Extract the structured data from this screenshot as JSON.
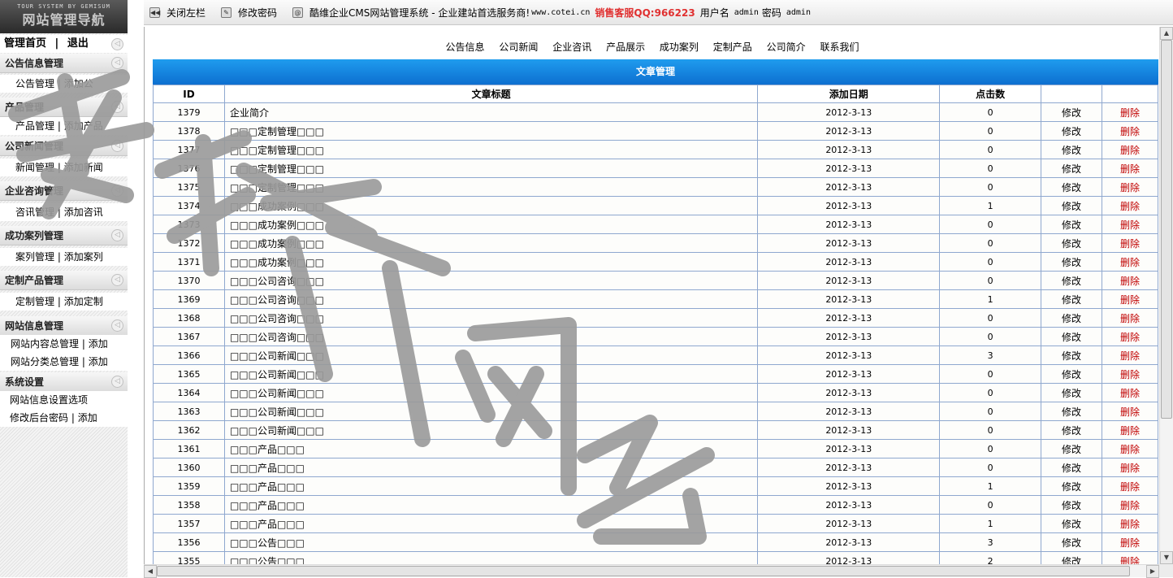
{
  "sidebar": {
    "logo_small": "TOUR SYSTEM BY GEMISUM",
    "logo_big": "网站管理导航",
    "top_links": [
      "管理首页",
      "退出"
    ],
    "sections": [
      {
        "title": "公告信息管理",
        "links": [
          "公告管理",
          "添加公"
        ]
      },
      {
        "title": "产品管理",
        "links": [
          "产品管理",
          "添加产品"
        ]
      },
      {
        "title": "公司新闻管理",
        "links": [
          "新闻管理",
          "添加新闻"
        ]
      },
      {
        "title": "企业咨询管理",
        "links": [
          "咨讯管理",
          "添加咨讯"
        ]
      },
      {
        "title": "成功案列管理",
        "links": [
          "案列管理",
          "添加案列"
        ]
      },
      {
        "title": "定制产品管理",
        "links": [
          "定制管理",
          "添加定制"
        ]
      },
      {
        "title": "网站信息管理",
        "lines": [
          [
            "网站内容总管理",
            "添加"
          ],
          [
            "网站分类总管理",
            "添加"
          ]
        ]
      },
      {
        "title": "系统设置",
        "lines": [
          [
            "网站信息设置选项"
          ],
          [
            "修改后台密码",
            "添加"
          ]
        ]
      }
    ]
  },
  "toolbar": {
    "close_left": "关闭左栏",
    "change_pwd": "修改密码",
    "system_title": "酷维企业CMS网站管理系统 - 企业建站首选服务商!",
    "site_url": "www.cotei.cn",
    "sales_qq": "销售客服QQ:966223",
    "user_label": "用户名",
    "user_value": "admin",
    "pwd_label": "密码",
    "pwd_value": "admin"
  },
  "category_nav": [
    "公告信息",
    "公司新闻",
    "企业咨讯",
    "产品展示",
    "成功案列",
    "定制产品",
    "公司简介",
    "联系我们"
  ],
  "banner_title": "文章管理",
  "table": {
    "headers": [
      "ID",
      "文章标题",
      "添加日期",
      "点击数",
      "",
      ""
    ],
    "edit_label": "修改",
    "delete_label": "删除",
    "rows": [
      {
        "id": "1379",
        "title": "企业简介",
        "date": "2012-3-13",
        "clicks": "0"
      },
      {
        "id": "1378",
        "title": "□□□定制管理□□□",
        "date": "2012-3-13",
        "clicks": "0"
      },
      {
        "id": "1377",
        "title": "□□□定制管理□□□",
        "date": "2012-3-13",
        "clicks": "0"
      },
      {
        "id": "1376",
        "title": "□□□定制管理□□□",
        "date": "2012-3-13",
        "clicks": "0"
      },
      {
        "id": "1375",
        "title": "□□□定制管理□□□",
        "date": "2012-3-13",
        "clicks": "0"
      },
      {
        "id": "1374",
        "title": "□□□成功案例□□□",
        "date": "2012-3-13",
        "clicks": "1"
      },
      {
        "id": "1373",
        "title": "□□□成功案例□□□",
        "date": "2012-3-13",
        "clicks": "0"
      },
      {
        "id": "1372",
        "title": "□□□成功案例□□□",
        "date": "2012-3-13",
        "clicks": "0"
      },
      {
        "id": "1371",
        "title": "□□□成功案例□□□",
        "date": "2012-3-13",
        "clicks": "0"
      },
      {
        "id": "1370",
        "title": "□□□公司咨询□□□",
        "date": "2012-3-13",
        "clicks": "0"
      },
      {
        "id": "1369",
        "title": "□□□公司咨询□□□",
        "date": "2012-3-13",
        "clicks": "1"
      },
      {
        "id": "1368",
        "title": "□□□公司咨询□□□",
        "date": "2012-3-13",
        "clicks": "0"
      },
      {
        "id": "1367",
        "title": "□□□公司咨询□□□",
        "date": "2012-3-13",
        "clicks": "0"
      },
      {
        "id": "1366",
        "title": "□□□公司新闻□□□",
        "date": "2012-3-13",
        "clicks": "3"
      },
      {
        "id": "1365",
        "title": "□□□公司新闻□□□",
        "date": "2012-3-13",
        "clicks": "0"
      },
      {
        "id": "1364",
        "title": "□□□公司新闻□□□",
        "date": "2012-3-13",
        "clicks": "0"
      },
      {
        "id": "1363",
        "title": "□□□公司新闻□□□",
        "date": "2012-3-13",
        "clicks": "0"
      },
      {
        "id": "1362",
        "title": "□□□公司新闻□□□",
        "date": "2012-3-13",
        "clicks": "0"
      },
      {
        "id": "1361",
        "title": "□□□产品□□□",
        "date": "2012-3-13",
        "clicks": "0"
      },
      {
        "id": "1360",
        "title": "□□□产品□□□",
        "date": "2012-3-13",
        "clicks": "0"
      },
      {
        "id": "1359",
        "title": "□□□产品□□□",
        "date": "2012-3-13",
        "clicks": "1"
      },
      {
        "id": "1358",
        "title": "□□□产品□□□",
        "date": "2012-3-13",
        "clicks": "0"
      },
      {
        "id": "1357",
        "title": "□□□产品□□□",
        "date": "2012-3-13",
        "clicks": "1"
      },
      {
        "id": "1356",
        "title": "□□□公告□□□",
        "date": "2012-3-13",
        "clicks": "3"
      },
      {
        "id": "1355",
        "title": "□□□公告□□□",
        "date": "2012-3-13",
        "clicks": "2"
      }
    ]
  },
  "watermark_text": "老榕树网络",
  "colors": {
    "banner": "#1485e0",
    "delete": "#c00000",
    "sales": "#e03030",
    "grid": "#8fa8cf"
  }
}
